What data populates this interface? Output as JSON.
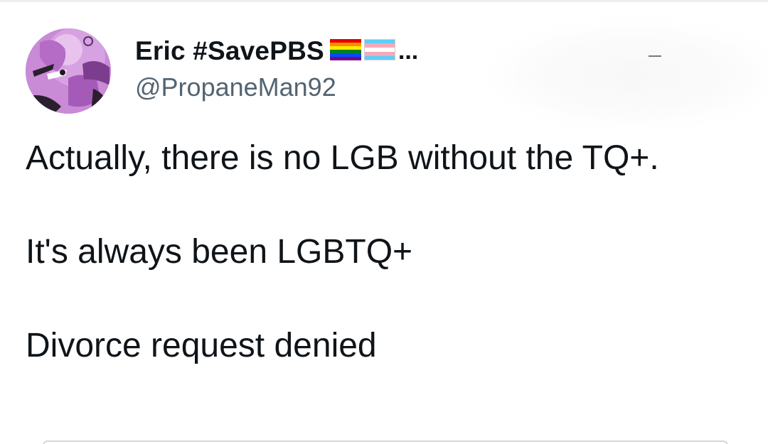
{
  "tweet": {
    "author": {
      "display_name": "Eric #SavePBS",
      "flags": [
        "rainbow-flag-icon",
        "transgender-flag-icon"
      ],
      "truncation": "...",
      "handle": "@PropaneMan92"
    },
    "text": {
      "paragraph_1": "Actually, there is no LGB without the TQ+.",
      "paragraph_2": "It's always been LGBTQ+",
      "paragraph_3": "Divorce request denied"
    }
  },
  "colors": {
    "text_primary": "#0f1419",
    "text_secondary": "#536471",
    "avatar_bg": "#c98ad6"
  }
}
